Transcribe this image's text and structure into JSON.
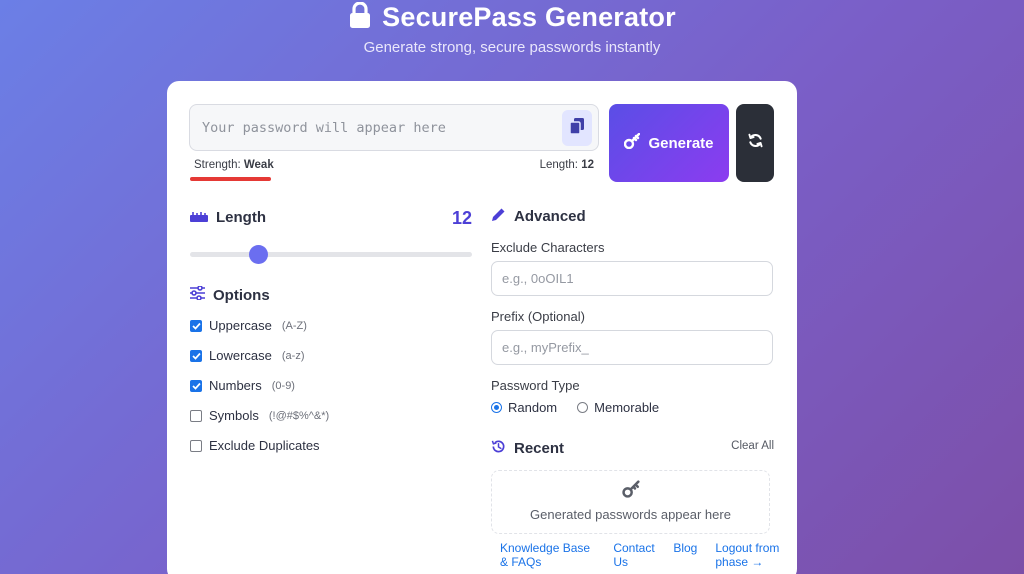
{
  "header": {
    "title": "SecurePass Generator",
    "subtitle": "Generate strong, secure passwords instantly",
    "icon": "lock-icon"
  },
  "password": {
    "placeholder": "Your password will appear here",
    "value": "",
    "copy_icon": "copy-icon"
  },
  "actions": {
    "generate_label": "Generate",
    "generate_icon": "key-icon",
    "refresh_icon": "refresh-icon"
  },
  "strength": {
    "label": "Strength:",
    "value": "Weak",
    "color": "#e53935"
  },
  "length_info": {
    "label": "Length:",
    "value": "12"
  },
  "length_section": {
    "title": "Length",
    "value": "12",
    "slider_value": 12,
    "icon": "ruler-icon"
  },
  "options": {
    "title": "Options",
    "icon": "sliders-icon",
    "items": [
      {
        "label": "Uppercase",
        "hint": "(A-Z)",
        "checked": true
      },
      {
        "label": "Lowercase",
        "hint": "(a-z)",
        "checked": true
      },
      {
        "label": "Numbers",
        "hint": "(0-9)",
        "checked": true
      },
      {
        "label": "Symbols",
        "hint": "(!@#$%^&*)",
        "checked": false
      },
      {
        "label": "Exclude Duplicates",
        "hint": "",
        "checked": false
      }
    ]
  },
  "advanced": {
    "title": "Advanced",
    "icon": "pencil-icon",
    "exclude_label": "Exclude Characters",
    "exclude_placeholder": "e.g., 0oOIL1",
    "prefix_label": "Prefix (Optional)",
    "prefix_placeholder": "e.g., myPrefix_",
    "type_label": "Password Type",
    "type_options": [
      {
        "label": "Random",
        "selected": true
      },
      {
        "label": "Memorable",
        "selected": false
      }
    ]
  },
  "recent": {
    "title": "Recent",
    "icon": "history-icon",
    "clear_label": "Clear All",
    "empty_text": "Generated passwords appear here",
    "empty_icon": "key-icon"
  },
  "footer": {
    "links": [
      "Knowledge Base & FAQs",
      "Contact Us",
      "Blog",
      "Logout from phase →"
    ]
  },
  "colors": {
    "accent": "#4c3fd6",
    "link": "#1a73e8",
    "checkbox": "#1a73e8"
  }
}
